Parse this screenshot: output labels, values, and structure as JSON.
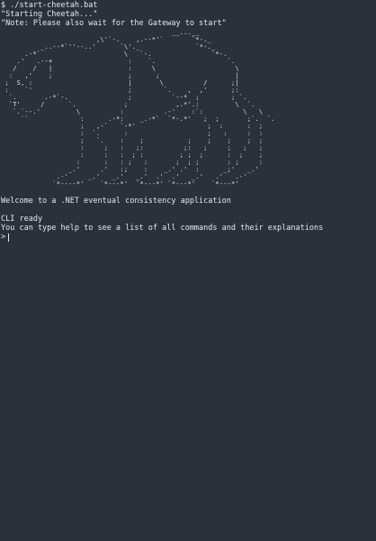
{
  "terminal": {
    "command_line": "$ ./start-cheetah.bat",
    "starting_msg": "\"Starting Cheetah...\"",
    "note_msg": "\"Note: Please also wait for the Gateway to start\"",
    "ascii_art": "                                           __...__\n                        ,\\'`-.    ,.--*'`       `*-._\n          _..--*`''--..'      `\\'._              `*-._    \n      .-*`                     \\   `-.               `*-.\n    .'   .--+                   :    `.                  `.\n   /    /   |                   :     \\                    \\\n  :   ,'    ;                   ;      ;                   |\n ;  S, :                        |       \\          /      ;|\n :    `'                        ;        `.    ,  ,'      ;:\n  `.       .-*`-.               ;          `--*  ;        ; `.\n  `T'     /      `.            ;            ,.*'.:         \\  `.\n   `.`--.'         \\          :          .-'    :`:          \\   \\\n     ``             :      .-*:    _.-*`  `*-.*'   ;  ;       ;`.  `.\n                    ;   ,-`   `-*'                  ;  :      :  ;\n                    :  `.      :                    ;   :     :  :\n                    ;   `.    :    ;           ;    ;    ;    ;  ;\n                    :     ;   :   ;:          ;:   ;     ;   ;   ;\n                    :     :   :  ; :         ; ;  ;      :  ;    ;\n                   :      :   : ;   :       ;  ; ;       : ;     :\n                 _.'     .'   :;    :    _.' .'  :      _;'   _.'\n              .-'     _.'   _.'   _.'  .'  .'   _.'   .'   .-'\n             `*----*'    `*---*'  `*---*' `*---*'    `*---*'",
    "welcome": "Welcome to a .NET eventual consistency application",
    "cli_ready": "CLI ready",
    "help_hint": "You can type help to see a list of all commands and their explanations",
    "prompt_symbol": ">"
  }
}
